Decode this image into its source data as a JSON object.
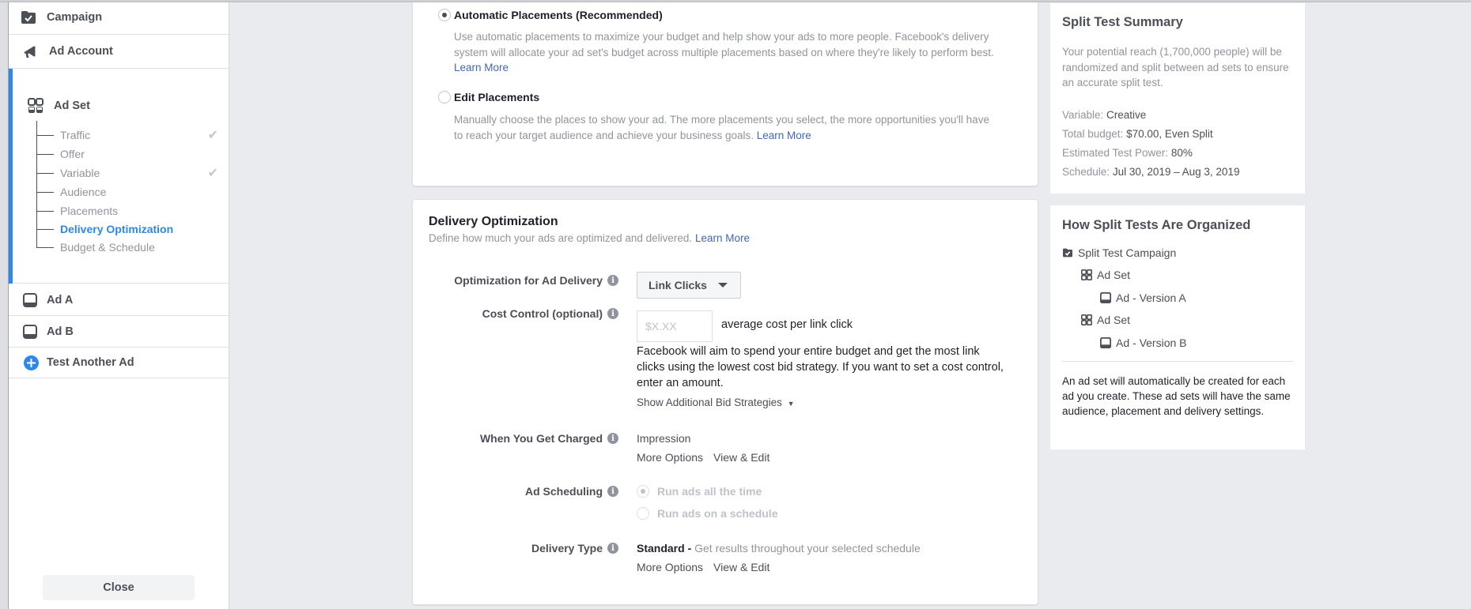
{
  "sidebar": {
    "campaign_label": "Campaign",
    "ad_account_label": "Ad Account",
    "ad_set_label": "Ad Set",
    "ad_set_steps": [
      {
        "label": "Traffic",
        "done": true,
        "active": false
      },
      {
        "label": "Offer",
        "done": false,
        "active": false
      },
      {
        "label": "Variable",
        "done": true,
        "active": false
      },
      {
        "label": "Audience",
        "done": false,
        "active": false
      },
      {
        "label": "Placements",
        "done": false,
        "active": false
      },
      {
        "label": "Delivery Optimization",
        "done": false,
        "active": true
      },
      {
        "label": "Budget & Schedule",
        "done": false,
        "active": false
      }
    ],
    "ad_a_label": "Ad A",
    "ad_b_label": "Ad B",
    "test_another_label": "Test Another Ad",
    "close_label": "Close",
    "accent_color": "#2d88e9"
  },
  "placements": {
    "automatic": {
      "title": "Automatic Placements (Recommended)",
      "selected": true,
      "desc": "Use automatic placements to maximize your budget and help show your ads to more people. Facebook's delivery system will allocate your ad set's budget across multiple placements based on where they're likely to perform best.",
      "link": "Learn More"
    },
    "edit": {
      "title": "Edit Placements",
      "selected": false,
      "desc": "Manually choose the places to show your ad. The more placements you select, the more opportunities you'll have to reach your target audience and achieve your business goals.",
      "link": "Learn More"
    }
  },
  "delivery": {
    "title": "Delivery Optimization",
    "subtitle": "Define how much your ads are optimized and delivered.",
    "subtitle_link": "Learn More",
    "optimization_label": "Optimization for Ad Delivery",
    "optimization_value": "Link Clicks",
    "cost_control_label": "Cost Control (optional)",
    "cost_placeholder": "$X.XX",
    "cost_value": "",
    "cost_suffix": "average cost per link click",
    "cost_help": "Facebook will aim to spend your entire budget and get the most link clicks using the lowest cost bid strategy. If you want to set a cost control, enter an amount.",
    "show_bid_strategies": "Show Additional Bid Strategies",
    "charged_label": "When You Get Charged",
    "charged_value": "Impression",
    "more_options": "More Options",
    "view_edit": "View & Edit",
    "scheduling_label": "Ad Scheduling",
    "scheduling_options": [
      {
        "label": "Run ads all the time",
        "selected": true
      },
      {
        "label": "Run ads on a schedule",
        "selected": false
      }
    ],
    "delivery_type_label": "Delivery Type",
    "delivery_type_value": "Standard -",
    "delivery_type_desc": "Get results throughout your selected schedule",
    "more_options_2": "More Options",
    "view_edit_2": "View & Edit"
  },
  "summary": {
    "title": "Split Test Summary",
    "desc": "Your potential reach (1,700,000 people) will be randomized and split between ad sets to ensure an accurate split test.",
    "variable_key": "Variable:",
    "variable_val": "Creative",
    "budget_key": "Total budget:",
    "budget_val": "$70.00, Even Split",
    "power_key": "Estimated Test Power:",
    "power_val": "80%",
    "schedule_key": "Schedule:",
    "schedule_val": "Jul 30, 2019 – Aug 3, 2019"
  },
  "organization": {
    "title": "How Split Tests Are Organized",
    "campaign": "Split Test Campaign",
    "ad_set_1": "Ad Set",
    "ad_a": "Ad - Version A",
    "ad_set_2": "Ad Set",
    "ad_b": "Ad - Version B",
    "footer": "An ad set will automatically be created for each ad you create. These ad sets will have the same audience, placement and delivery settings."
  }
}
